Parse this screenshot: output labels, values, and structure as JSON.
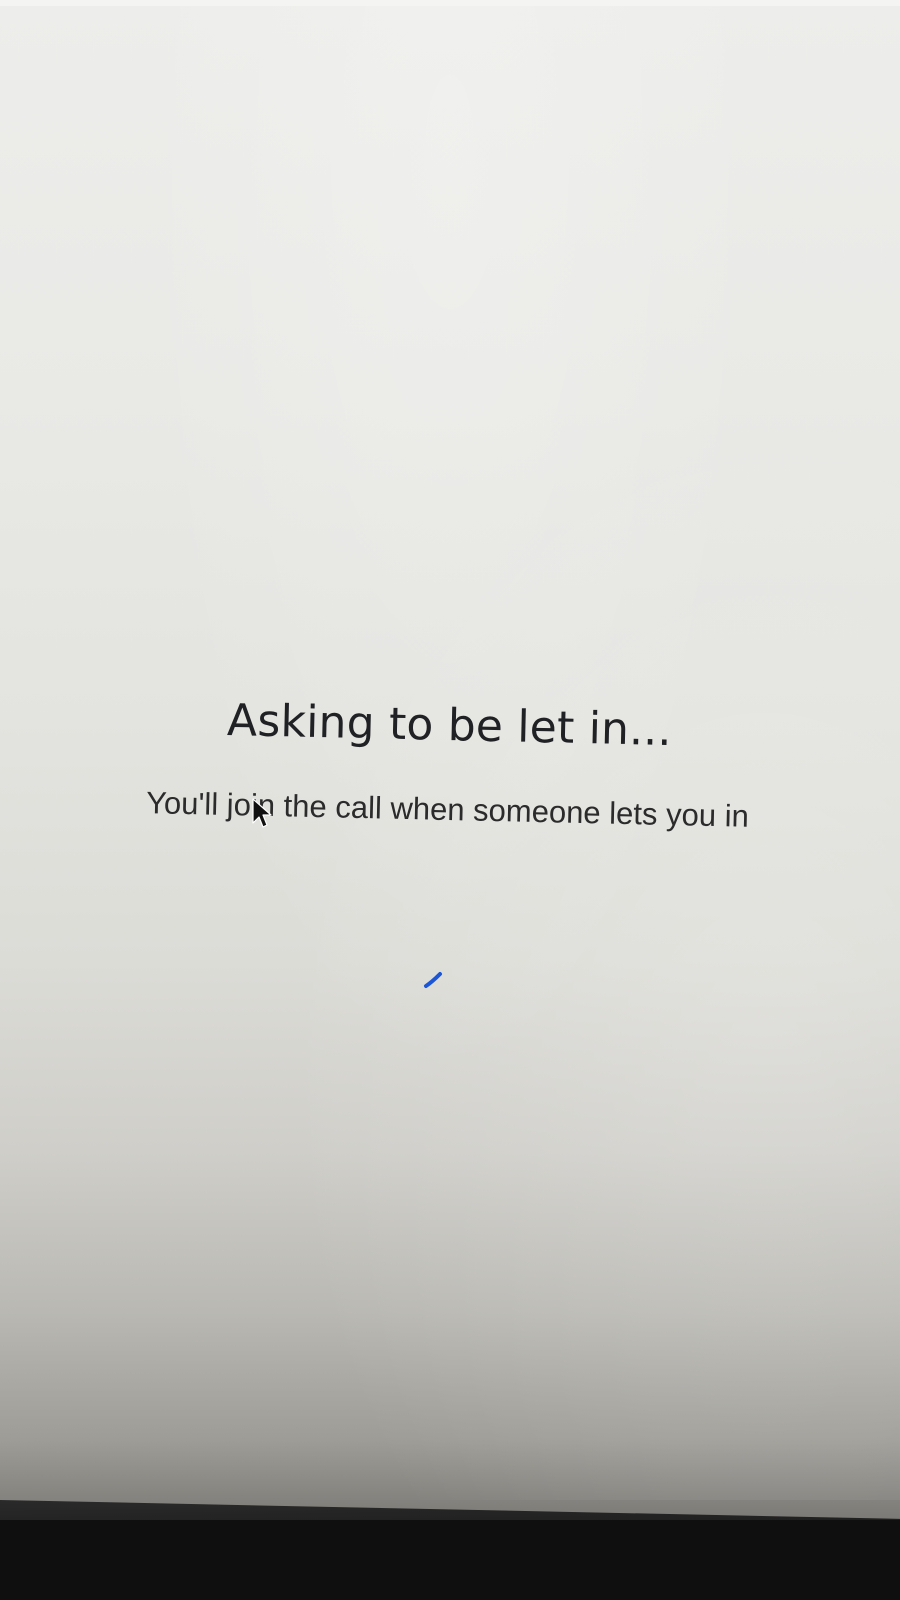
{
  "waiting_screen": {
    "title": "Asking to be let in...",
    "subtitle": "You'll join the call when someone lets you in"
  },
  "spinner": {
    "icon": "loading-spinner-icon",
    "color": "#1a56d6"
  },
  "cursor": {
    "icon": "mouse-cursor-icon"
  },
  "colors": {
    "text_primary": "#202124",
    "text_secondary": "#2b2b2b",
    "screen_background": "#e9e9e6"
  }
}
